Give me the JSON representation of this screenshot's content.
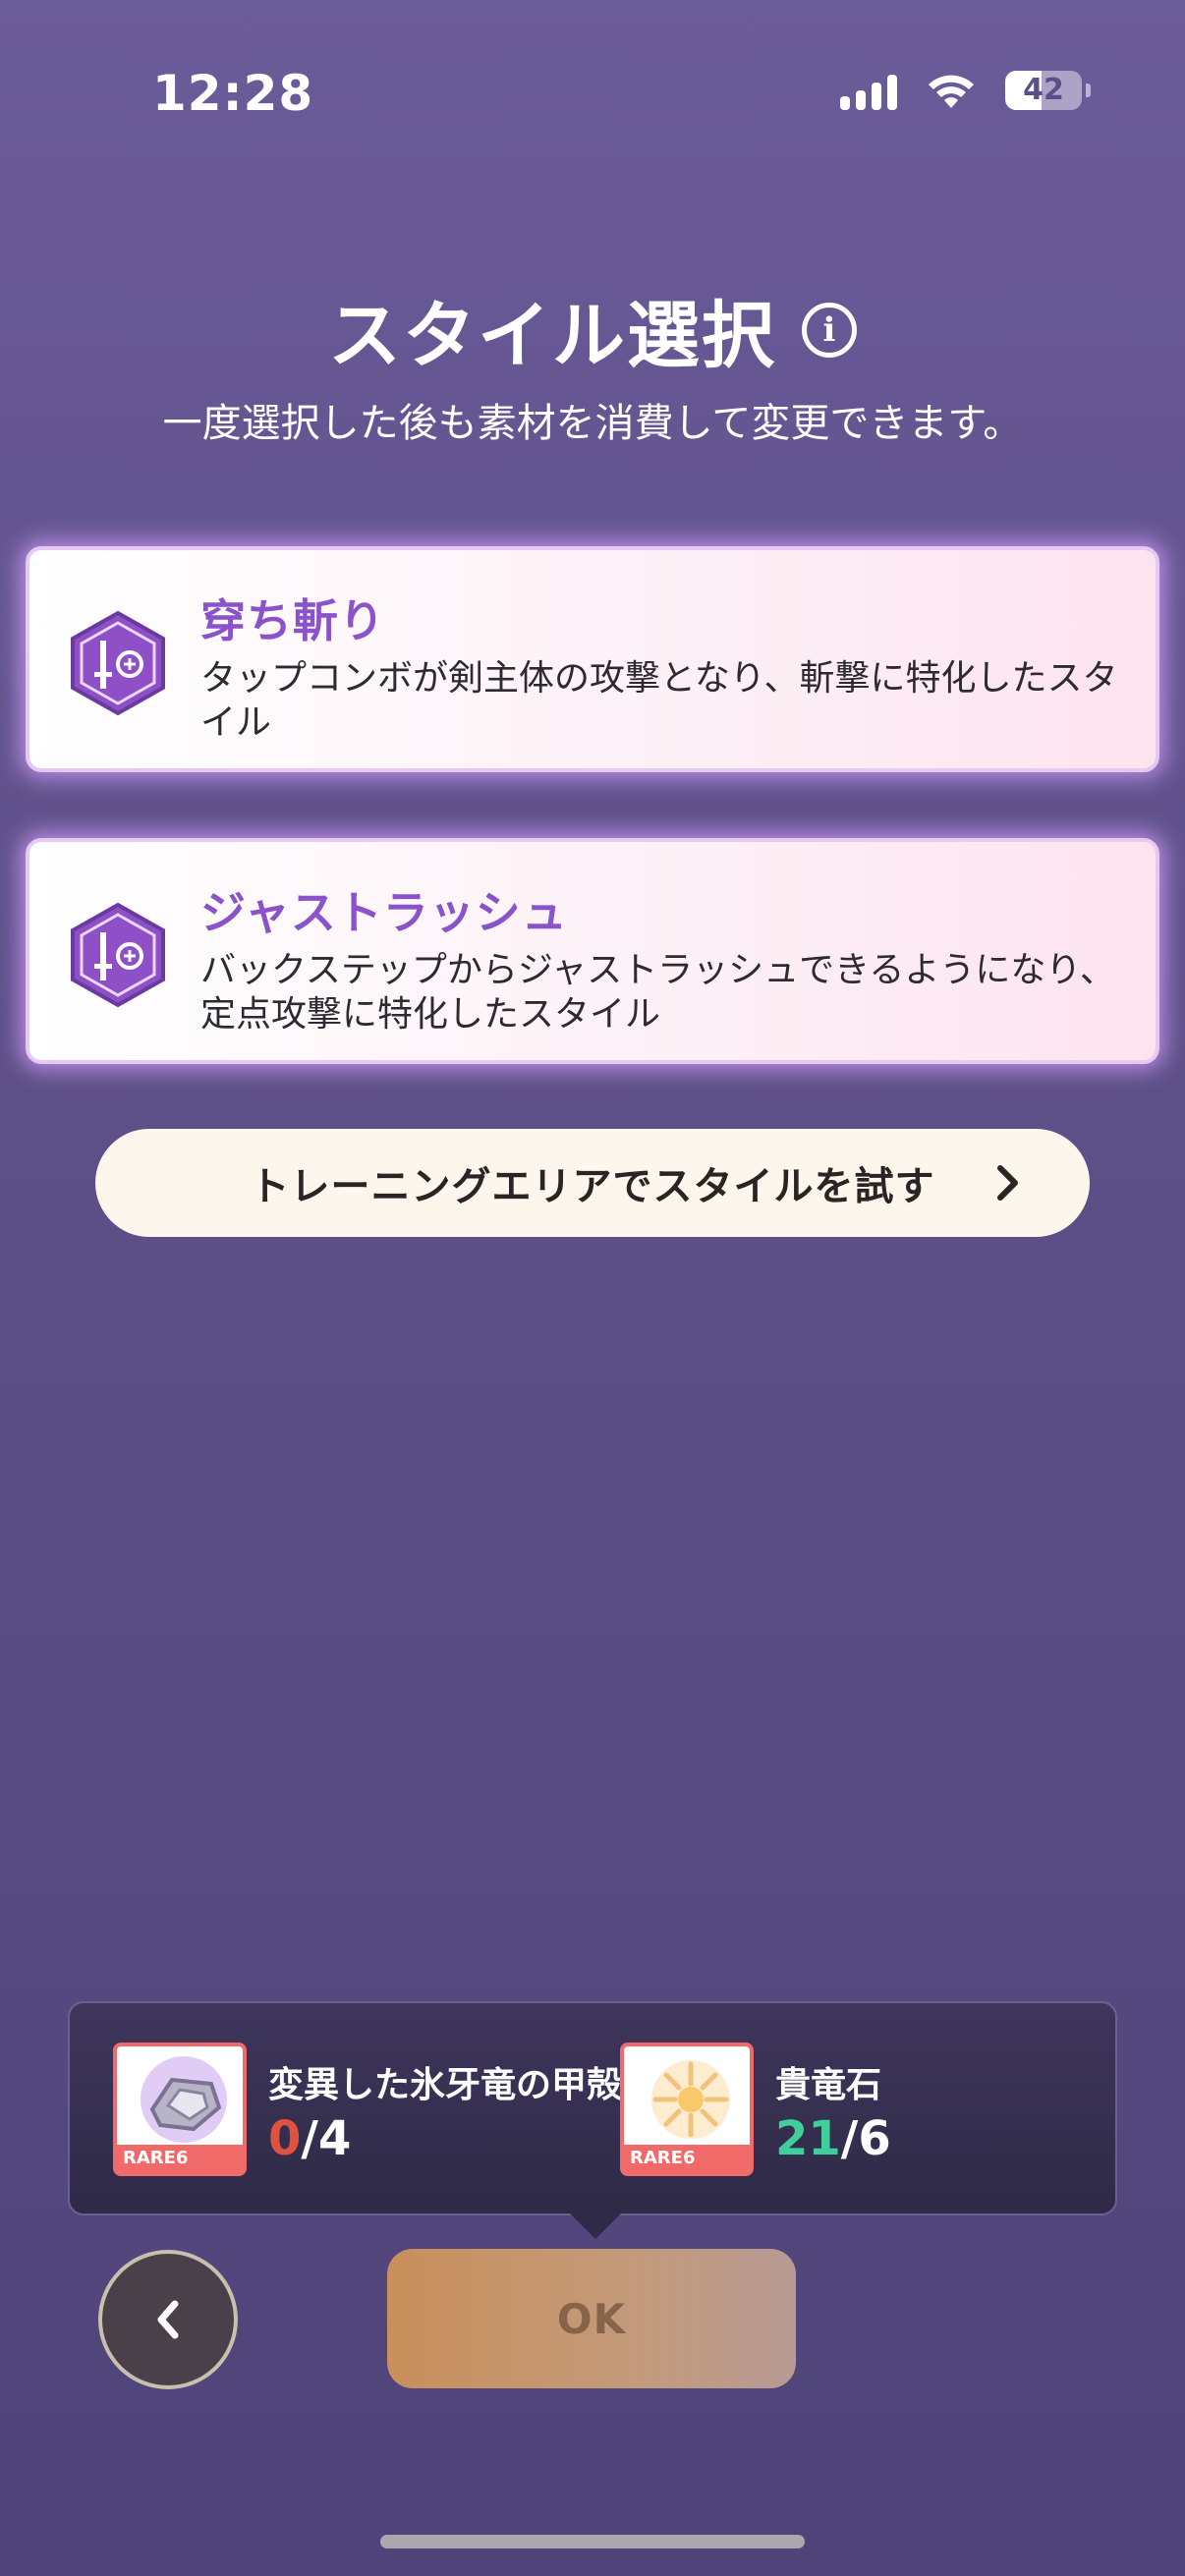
{
  "status_bar": {
    "time": "12:28",
    "battery_level": "42",
    "icons": [
      "cellular-signal-icon",
      "wifi-icon",
      "battery-icon"
    ]
  },
  "header": {
    "title": "スタイル選択",
    "info_icon": "info-icon",
    "subtitle": "一度選択した後も素材を消費して変更できます。"
  },
  "styles": [
    {
      "name": "穿ち斬り",
      "description": "タップコンボが剣主体の攻撃となり、斬撃に特化したスタイル",
      "icon": "sword-shield-hexagon-icon"
    },
    {
      "name": "ジャストラッシュ",
      "description": "バックステップからジャストラッシュできるようになり、定点攻撃に特化したスタイル",
      "icon": "sword-shield-hexagon-icon"
    }
  ],
  "training_button": {
    "label": "トレーニングエリアでスタイルを試す",
    "icon": "chevron-right-icon"
  },
  "materials": [
    {
      "name": "変異した氷牙竜の甲殻",
      "rarity": "RARE6",
      "owned": "0",
      "required": "/4",
      "owned_color": "#e0513f"
    },
    {
      "name": "貴竜石",
      "rarity": "RARE6",
      "owned": "21",
      "required": "/6",
      "owned_color": "#3fcf9b"
    }
  ],
  "buttons": {
    "back_icon": "chevron-left-icon",
    "ok_label": "OK"
  },
  "colors": {
    "accent_purple": "#8b53c9",
    "background": "#5e5089"
  }
}
